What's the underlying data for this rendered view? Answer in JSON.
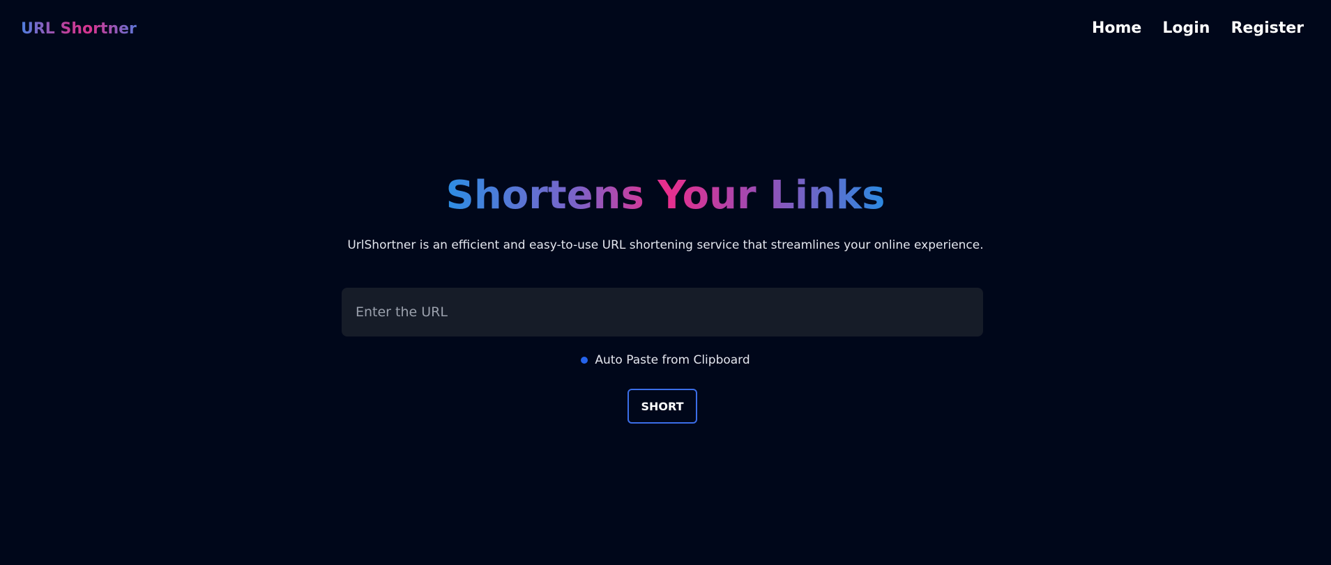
{
  "navbar": {
    "brand": "URL Shortner",
    "links": [
      {
        "label": "Home"
      },
      {
        "label": "Login"
      },
      {
        "label": "Register"
      }
    ]
  },
  "hero": {
    "title": "Shortens Your Links",
    "subtitle": "UrlShortner is an efficient and easy-to-use URL shortening service that streamlines your online experience."
  },
  "form": {
    "url_placeholder": "Enter the URL",
    "url_value": "",
    "auto_paste_label": "Auto Paste from Clipboard",
    "submit_label": "SHORT"
  },
  "colors": {
    "background": "#00071a",
    "input_background": "#161c28",
    "accent_blue": "#2563eb",
    "gradient_pink": "#ea2e8c",
    "gradient_blue": "#2d8ee4"
  }
}
